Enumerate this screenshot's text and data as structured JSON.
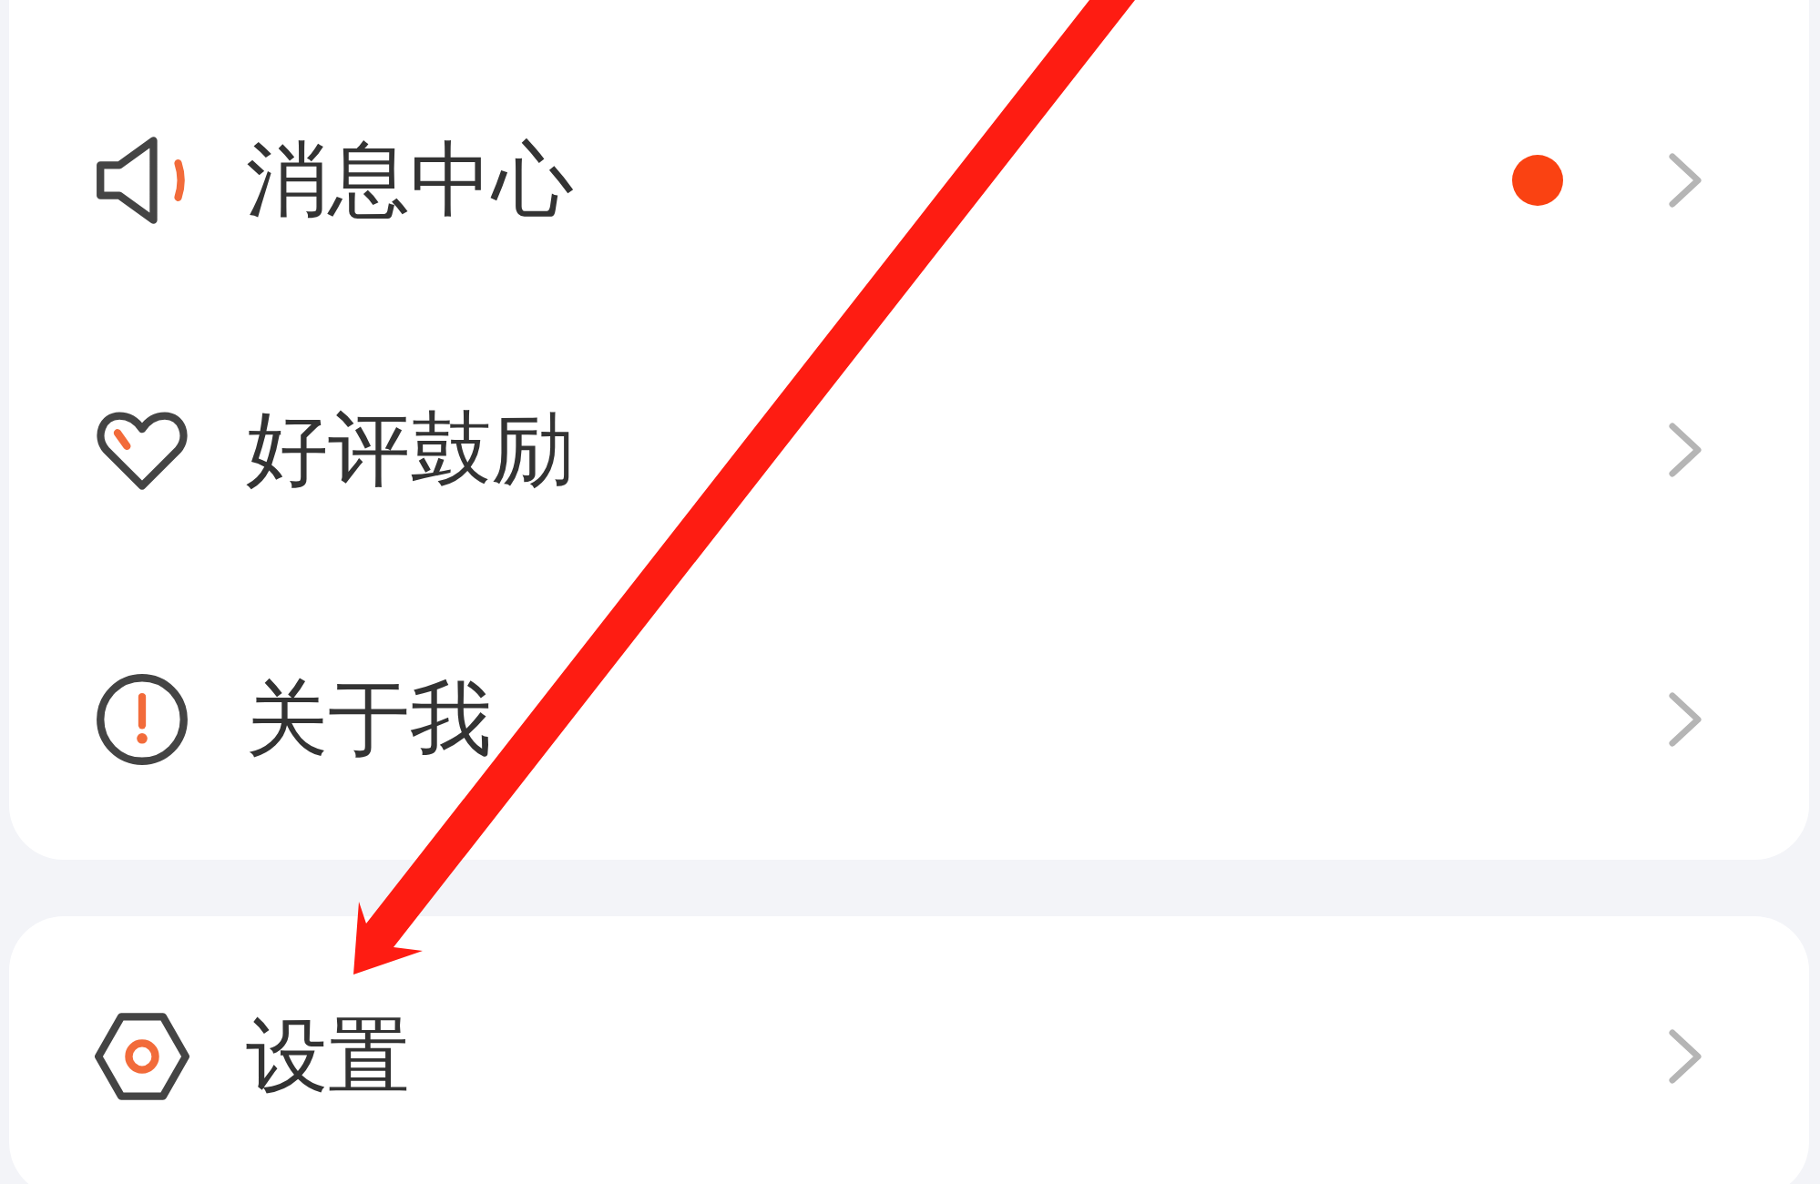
{
  "groups": [
    {
      "items": [
        {
          "label": "消息中心",
          "unread": true
        },
        {
          "label": "好评鼓励",
          "unread": false
        },
        {
          "label": "关于我",
          "unread": false
        }
      ]
    },
    {
      "items": [
        {
          "label": "设置",
          "unread": false
        }
      ]
    }
  ],
  "annotations": [
    {
      "kind": "arrow"
    }
  ]
}
